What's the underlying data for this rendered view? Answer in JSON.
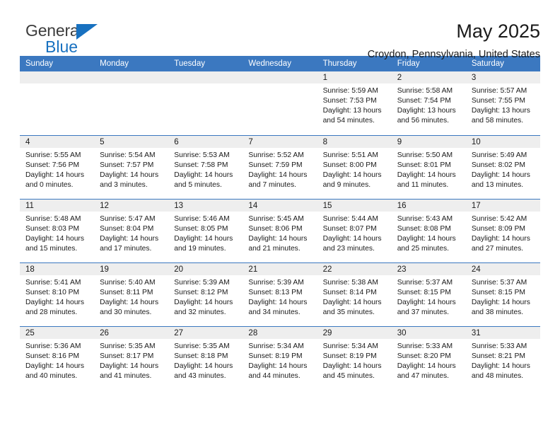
{
  "brand": {
    "name_part1": "General",
    "name_part2": "Blue",
    "triangle_color": "#1871c0",
    "text_color": "#3c3c3c"
  },
  "header": {
    "title": "May 2025",
    "subtitle": "Croydon, Pennsylvania, United States"
  },
  "theme": {
    "header_blue": "#3b78c0",
    "daynum_band": "#eeeeee",
    "divider": "#3b78c0"
  },
  "weekday_headers": [
    "Sunday",
    "Monday",
    "Tuesday",
    "Wednesday",
    "Thursday",
    "Friday",
    "Saturday"
  ],
  "weeks": [
    [
      {
        "day": "",
        "lines": []
      },
      {
        "day": "",
        "lines": []
      },
      {
        "day": "",
        "lines": []
      },
      {
        "day": "",
        "lines": []
      },
      {
        "day": "1",
        "lines": [
          "Sunrise: 5:59 AM",
          "Sunset: 7:53 PM",
          "Daylight: 13 hours",
          "and 54 minutes."
        ]
      },
      {
        "day": "2",
        "lines": [
          "Sunrise: 5:58 AM",
          "Sunset: 7:54 PM",
          "Daylight: 13 hours",
          "and 56 minutes."
        ]
      },
      {
        "day": "3",
        "lines": [
          "Sunrise: 5:57 AM",
          "Sunset: 7:55 PM",
          "Daylight: 13 hours",
          "and 58 minutes."
        ]
      }
    ],
    [
      {
        "day": "4",
        "lines": [
          "Sunrise: 5:55 AM",
          "Sunset: 7:56 PM",
          "Daylight: 14 hours",
          "and 0 minutes."
        ]
      },
      {
        "day": "5",
        "lines": [
          "Sunrise: 5:54 AM",
          "Sunset: 7:57 PM",
          "Daylight: 14 hours",
          "and 3 minutes."
        ]
      },
      {
        "day": "6",
        "lines": [
          "Sunrise: 5:53 AM",
          "Sunset: 7:58 PM",
          "Daylight: 14 hours",
          "and 5 minutes."
        ]
      },
      {
        "day": "7",
        "lines": [
          "Sunrise: 5:52 AM",
          "Sunset: 7:59 PM",
          "Daylight: 14 hours",
          "and 7 minutes."
        ]
      },
      {
        "day": "8",
        "lines": [
          "Sunrise: 5:51 AM",
          "Sunset: 8:00 PM",
          "Daylight: 14 hours",
          "and 9 minutes."
        ]
      },
      {
        "day": "9",
        "lines": [
          "Sunrise: 5:50 AM",
          "Sunset: 8:01 PM",
          "Daylight: 14 hours",
          "and 11 minutes."
        ]
      },
      {
        "day": "10",
        "lines": [
          "Sunrise: 5:49 AM",
          "Sunset: 8:02 PM",
          "Daylight: 14 hours",
          "and 13 minutes."
        ]
      }
    ],
    [
      {
        "day": "11",
        "lines": [
          "Sunrise: 5:48 AM",
          "Sunset: 8:03 PM",
          "Daylight: 14 hours",
          "and 15 minutes."
        ]
      },
      {
        "day": "12",
        "lines": [
          "Sunrise: 5:47 AM",
          "Sunset: 8:04 PM",
          "Daylight: 14 hours",
          "and 17 minutes."
        ]
      },
      {
        "day": "13",
        "lines": [
          "Sunrise: 5:46 AM",
          "Sunset: 8:05 PM",
          "Daylight: 14 hours",
          "and 19 minutes."
        ]
      },
      {
        "day": "14",
        "lines": [
          "Sunrise: 5:45 AM",
          "Sunset: 8:06 PM",
          "Daylight: 14 hours",
          "and 21 minutes."
        ]
      },
      {
        "day": "15",
        "lines": [
          "Sunrise: 5:44 AM",
          "Sunset: 8:07 PM",
          "Daylight: 14 hours",
          "and 23 minutes."
        ]
      },
      {
        "day": "16",
        "lines": [
          "Sunrise: 5:43 AM",
          "Sunset: 8:08 PM",
          "Daylight: 14 hours",
          "and 25 minutes."
        ]
      },
      {
        "day": "17",
        "lines": [
          "Sunrise: 5:42 AM",
          "Sunset: 8:09 PM",
          "Daylight: 14 hours",
          "and 27 minutes."
        ]
      }
    ],
    [
      {
        "day": "18",
        "lines": [
          "Sunrise: 5:41 AM",
          "Sunset: 8:10 PM",
          "Daylight: 14 hours",
          "and 28 minutes."
        ]
      },
      {
        "day": "19",
        "lines": [
          "Sunrise: 5:40 AM",
          "Sunset: 8:11 PM",
          "Daylight: 14 hours",
          "and 30 minutes."
        ]
      },
      {
        "day": "20",
        "lines": [
          "Sunrise: 5:39 AM",
          "Sunset: 8:12 PM",
          "Daylight: 14 hours",
          "and 32 minutes."
        ]
      },
      {
        "day": "21",
        "lines": [
          "Sunrise: 5:39 AM",
          "Sunset: 8:13 PM",
          "Daylight: 14 hours",
          "and 34 minutes."
        ]
      },
      {
        "day": "22",
        "lines": [
          "Sunrise: 5:38 AM",
          "Sunset: 8:14 PM",
          "Daylight: 14 hours",
          "and 35 minutes."
        ]
      },
      {
        "day": "23",
        "lines": [
          "Sunrise: 5:37 AM",
          "Sunset: 8:15 PM",
          "Daylight: 14 hours",
          "and 37 minutes."
        ]
      },
      {
        "day": "24",
        "lines": [
          "Sunrise: 5:37 AM",
          "Sunset: 8:15 PM",
          "Daylight: 14 hours",
          "and 38 minutes."
        ]
      }
    ],
    [
      {
        "day": "25",
        "lines": [
          "Sunrise: 5:36 AM",
          "Sunset: 8:16 PM",
          "Daylight: 14 hours",
          "and 40 minutes."
        ]
      },
      {
        "day": "26",
        "lines": [
          "Sunrise: 5:35 AM",
          "Sunset: 8:17 PM",
          "Daylight: 14 hours",
          "and 41 minutes."
        ]
      },
      {
        "day": "27",
        "lines": [
          "Sunrise: 5:35 AM",
          "Sunset: 8:18 PM",
          "Daylight: 14 hours",
          "and 43 minutes."
        ]
      },
      {
        "day": "28",
        "lines": [
          "Sunrise: 5:34 AM",
          "Sunset: 8:19 PM",
          "Daylight: 14 hours",
          "and 44 minutes."
        ]
      },
      {
        "day": "29",
        "lines": [
          "Sunrise: 5:34 AM",
          "Sunset: 8:19 PM",
          "Daylight: 14 hours",
          "and 45 minutes."
        ]
      },
      {
        "day": "30",
        "lines": [
          "Sunrise: 5:33 AM",
          "Sunset: 8:20 PM",
          "Daylight: 14 hours",
          "and 47 minutes."
        ]
      },
      {
        "day": "31",
        "lines": [
          "Sunrise: 5:33 AM",
          "Sunset: 8:21 PM",
          "Daylight: 14 hours",
          "and 48 minutes."
        ]
      }
    ]
  ]
}
